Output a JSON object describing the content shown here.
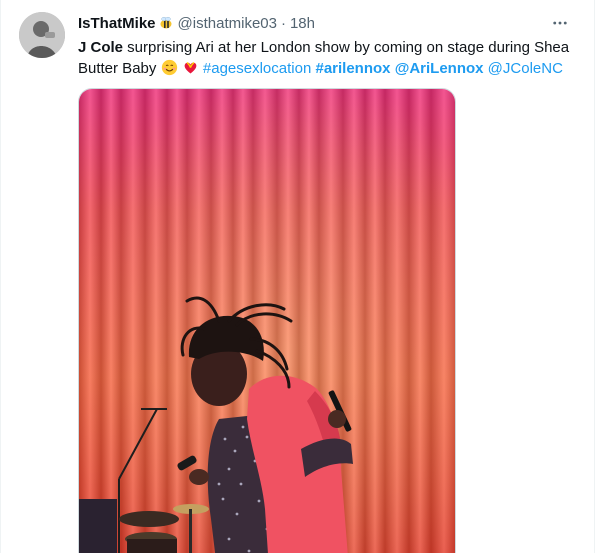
{
  "tweet": {
    "display_name": "IsThatMike",
    "badge_icon": "bee-emoji",
    "handle": "@isthatmike03",
    "separator": "·",
    "time": "18h",
    "more_icon": "more-horizontal-icon",
    "text": {
      "author_bold": "J Cole",
      "body": " surprising Ari at her London show by coming on stage during Shea Butter Baby ",
      "emojis": [
        "smiling-face-with-hearts-emoji",
        "heart-with-ribbon-emoji"
      ],
      "hashtag_1": "#agesexlocation",
      "hashtag_2": "#arilennox",
      "mention_1": "@AriLennox",
      "mention_2": "@JColeNC"
    },
    "media": {
      "description_icon": "concert-photo"
    }
  },
  "colors": {
    "text": "#0f1419",
    "muted": "#536471",
    "link": "#1d9bf0",
    "curtain_red": "#ef4a4a"
  }
}
